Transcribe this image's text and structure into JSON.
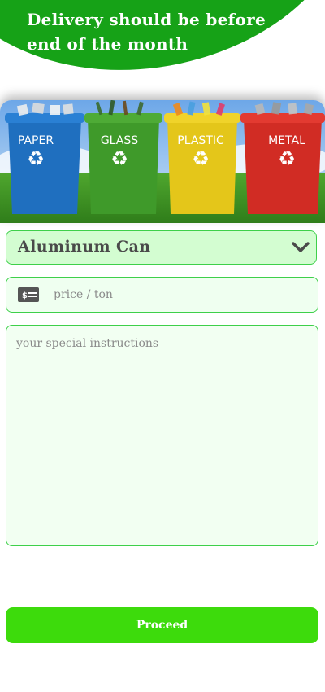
{
  "header": {
    "title": "Delivery should be before end of the month"
  },
  "banner": {
    "bins": [
      {
        "label": "PAPER",
        "color": "#1f6fbf"
      },
      {
        "label": "GLASS",
        "color": "#3f9a2a"
      },
      {
        "label": "PLASTIC",
        "color": "#e4c61a"
      },
      {
        "label": "METAL",
        "color": "#d12c24"
      }
    ]
  },
  "material_select": {
    "selected": "Aluminum Can"
  },
  "price_field": {
    "placeholder": "price / ton",
    "icon": "dollar-bill-icon"
  },
  "instructions_field": {
    "placeholder": "your special instructions"
  },
  "proceed_button": {
    "label": "Proceed"
  },
  "colors": {
    "header_green": "#16a217",
    "button_green": "#3ddb0c",
    "field_border": "#3ed04a"
  }
}
